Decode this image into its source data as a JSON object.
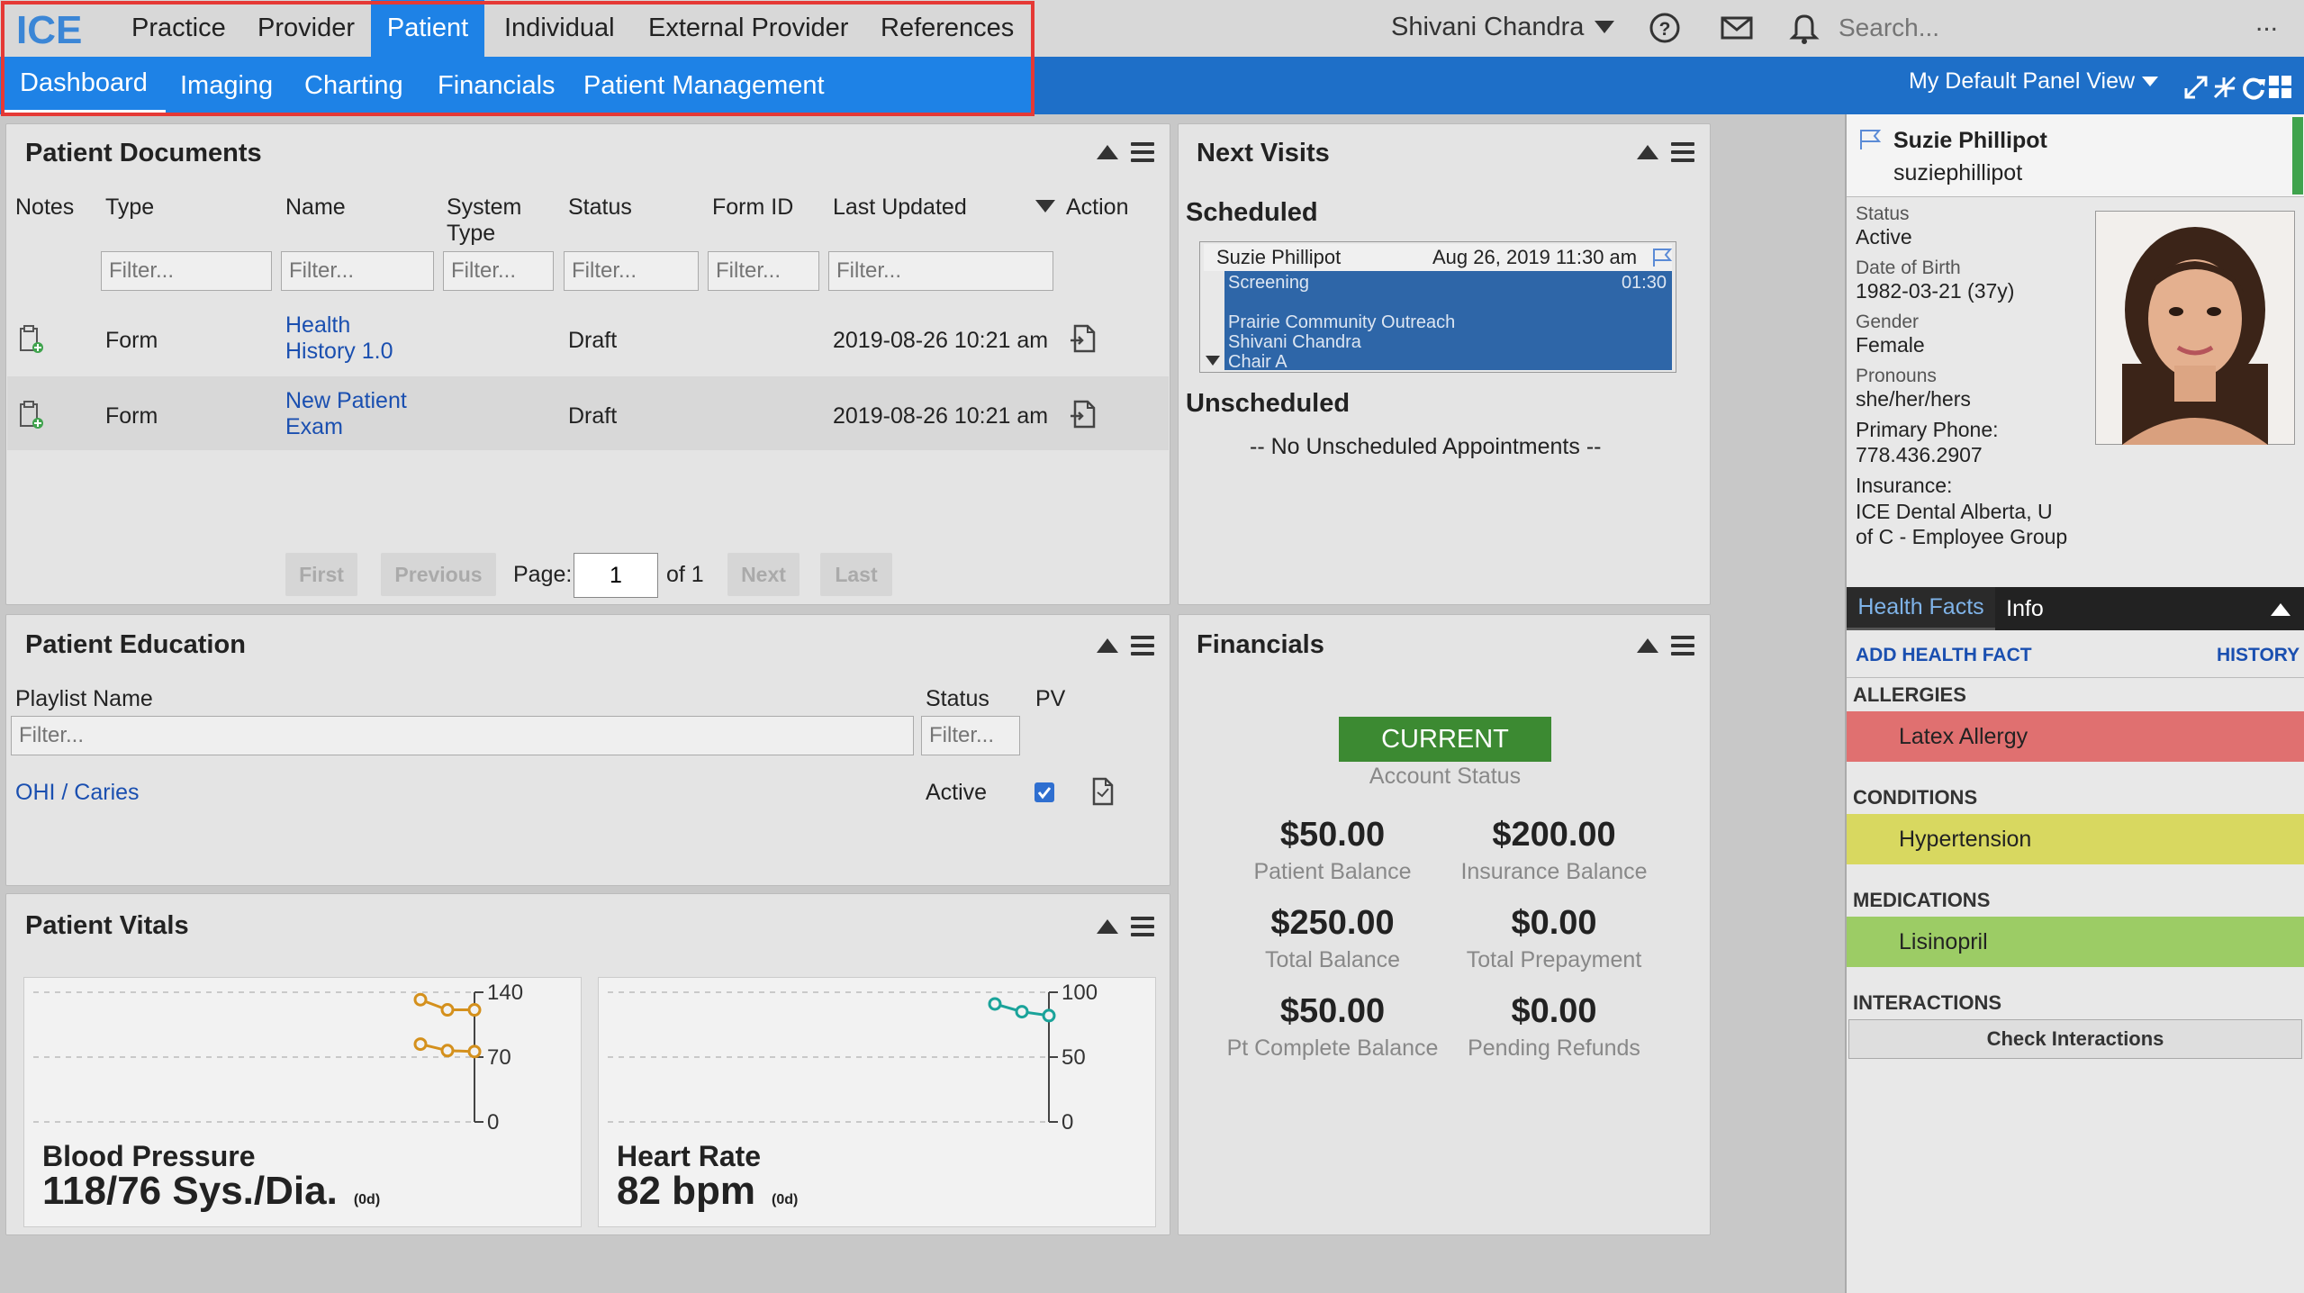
{
  "header": {
    "top_nav": [
      "Practice",
      "Provider",
      "Patient",
      "Individual",
      "External Provider",
      "References"
    ],
    "active_top": "Patient",
    "sub_nav": [
      "Dashboard",
      "Imaging",
      "Charting",
      "Financials",
      "Patient Management"
    ],
    "active_sub": "Dashboard",
    "user_name": "Shivani Chandra",
    "search_placeholder": "Search...",
    "more": "...",
    "panel_view": "My Default Panel View",
    "logo_text": "ICE"
  },
  "patient_documents": {
    "title": "Patient Documents",
    "columns": [
      "Notes",
      "Type",
      "Name",
      "System Type",
      "Status",
      "Form ID",
      "Last Updated",
      "Action"
    ],
    "filter_placeholder": "Filter...",
    "rows": [
      {
        "type": "Form",
        "name": "Health History 1.0",
        "status": "Draft",
        "updated": "2019-08-26 10:21 am"
      },
      {
        "type": "Form",
        "name": "New Patient Exam",
        "status": "Draft",
        "updated": "2019-08-26 10:21 am"
      }
    ],
    "pager": {
      "first": "First",
      "previous": "Previous",
      "page_label": "Page:",
      "page": "1",
      "of": "of 1",
      "next": "Next",
      "last": "Last"
    }
  },
  "next_visits": {
    "title": "Next Visits",
    "scheduled": "Scheduled",
    "appt": {
      "patient": "Suzie Phillipot",
      "datetime": "Aug 26, 2019  11:30 am",
      "type": "Screening",
      "duration": "01:30",
      "location": "Prairie Community Outreach",
      "provider": "Shivani Chandra",
      "chair": "Chair A"
    },
    "unscheduled": "Unscheduled",
    "no_unscheduled": "-- No Unscheduled Appointments --"
  },
  "patient_education": {
    "title": "Patient Education",
    "columns": [
      "Playlist Name",
      "Status",
      "PV"
    ],
    "filter_placeholder": "Filter...",
    "rows": [
      {
        "name": "OHI / Caries",
        "status": "Active"
      }
    ]
  },
  "financials": {
    "title": "Financials",
    "status": "CURRENT",
    "status_label": "Account Status",
    "items": [
      {
        "amount": "$50.00",
        "label": "Patient Balance"
      },
      {
        "amount": "$200.00",
        "label": "Insurance Balance"
      },
      {
        "amount": "$250.00",
        "label": "Total Balance"
      },
      {
        "amount": "$0.00",
        "label": "Total Prepayment"
      },
      {
        "amount": "$50.00",
        "label": "Pt Complete Balance"
      },
      {
        "amount": "$0.00",
        "label": "Pending Refunds"
      }
    ]
  },
  "patient_vitals": {
    "title": "Patient Vitals",
    "blood_pressure": {
      "label": "Blood Pressure",
      "value": "118/76 Sys./Dia.",
      "age": "(0d)",
      "ticks": [
        "140",
        "70",
        "0"
      ]
    },
    "heart_rate": {
      "label": "Heart Rate",
      "value": "82 bpm",
      "age": "(0d)",
      "ticks": [
        "100",
        "50",
        "0"
      ]
    }
  },
  "chart_data": [
    {
      "type": "line",
      "title": "Blood Pressure",
      "ylim": [
        0,
        140
      ],
      "series": [
        {
          "name": "",
          "values": [
            132,
            121,
            121
          ]
        },
        {
          "name": "",
          "values": [
            84,
            77,
            76
          ]
        }
      ],
      "color": "#d4901c"
    },
    {
      "type": "line",
      "title": "Heart Rate",
      "ylim": [
        0,
        100
      ],
      "series": [
        {
          "name": "",
          "values": [
            91,
            85,
            82
          ]
        }
      ],
      "color": "#1aa39a"
    }
  ],
  "patient_summary": {
    "name": "Suzie Phillipot",
    "username": "suziephillipot",
    "fields": [
      {
        "label": "Status",
        "value": "Active"
      },
      {
        "label": "Date of Birth",
        "value": "1982-03-21 (37y)"
      },
      {
        "label": "Gender",
        "value": "Female"
      },
      {
        "label": "Pronouns",
        "value": "she/her/hers"
      }
    ],
    "phone_label": "Primary Phone:",
    "phone": "778.436.2907",
    "insurance_label": "Insurance:",
    "insurance": "ICE Dental Alberta, U of C - Employee Group"
  },
  "health_facts": {
    "tabs": [
      "Health Facts",
      "Info"
    ],
    "add": "ADD HEALTH FACT",
    "history": "HISTORY",
    "allergies_label": "ALLERGIES",
    "allergy": "Latex Allergy",
    "conditions_label": "CONDITIONS",
    "condition": "Hypertension",
    "medications_label": "MEDICATIONS",
    "medication": "Lisinopril",
    "interactions_label": "INTERACTIONS",
    "check_button": "Check Interactions",
    "colors": {
      "allergy": "#e07070",
      "condition": "#d8d860",
      "medication": "#9ccc65"
    }
  }
}
